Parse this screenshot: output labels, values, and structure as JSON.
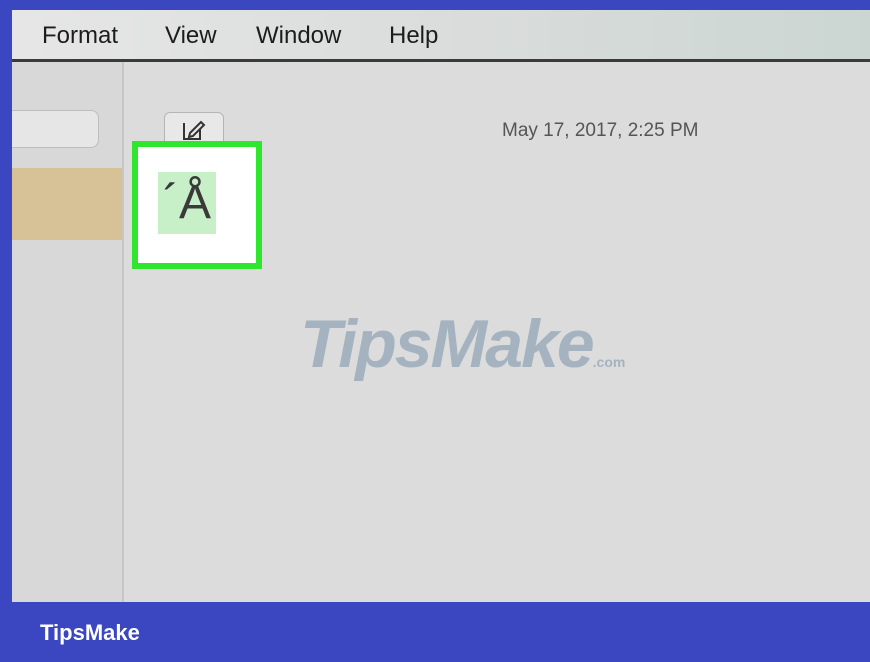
{
  "menubar": {
    "items": [
      "Format",
      "View",
      "Window",
      "Help"
    ]
  },
  "note": {
    "timestamp": "May 17, 2017, 2:25 PM",
    "typed_characters": "´Å"
  },
  "watermark": {
    "main": "TipsMake",
    "suffix": ".com"
  },
  "footer": {
    "brand": "TipsMake"
  },
  "colors": {
    "frame": "#3a47c0",
    "highlight": "#2ee62e",
    "selected_note": "#d6c296"
  }
}
